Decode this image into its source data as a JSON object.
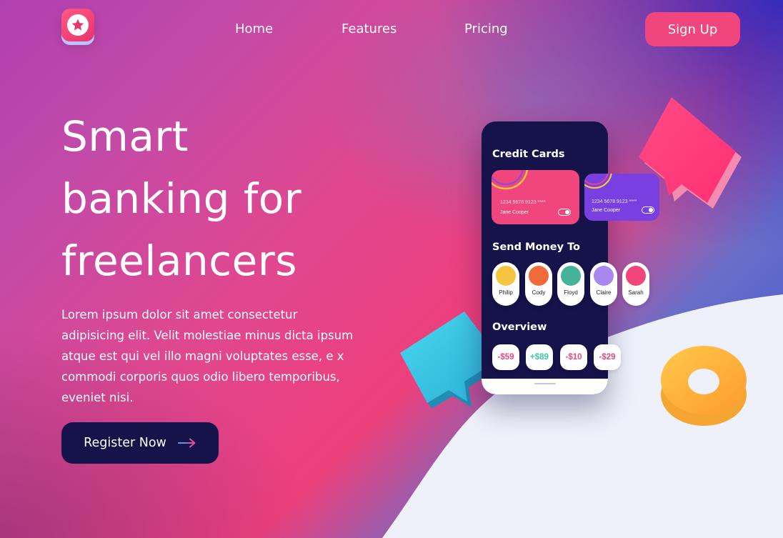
{
  "nav": {
    "logo_icon": "star-icon",
    "links": [
      "Home",
      "Features",
      "Pricing"
    ],
    "signup_label": "Sign Up"
  },
  "hero": {
    "title_lines": [
      "Smart",
      "banking for",
      "freelancers"
    ],
    "lead_lines": [
      "Lorem ipsum dolor sit amet consectetur",
      "adipisicing elit. Velit molestiae minus dicta ipsum",
      "atque est qui vel illo magni voluptates esse, e x",
      "commodi corporis quos odio libero temporibus,",
      "eveniet nisi."
    ],
    "cta_label": "Register Now",
    "cta_icon": "arrow-right-icon"
  },
  "phone": {
    "credit_title": "Credit Cards",
    "cards": [
      {
        "number": "1234 5678 9123 ****",
        "holder": "Jane Cooper",
        "color": "#f0457d"
      },
      {
        "number": "1234 5678 9123 ****",
        "holder": "Jane Cooper",
        "color": "#7a3fe0"
      }
    ],
    "send_title": "Send Money To",
    "contacts": [
      {
        "name": "Philip",
        "color": "#f5c542"
      },
      {
        "name": "Cody",
        "color": "#f06a3a"
      },
      {
        "name": "Floyd",
        "color": "#45b29a"
      },
      {
        "name": "Claire",
        "color": "#a987f0"
      },
      {
        "name": "Sarah",
        "color": "#f0457d"
      }
    ],
    "overview_title": "Overview",
    "amounts": [
      {
        "value": "-$59",
        "color": "#f0457d"
      },
      {
        "value": "+$89",
        "color": "#3cc7a8"
      },
      {
        "value": "-$10",
        "color": "#f0457d"
      },
      {
        "value": "-$29",
        "color": "#f0457d"
      }
    ]
  },
  "colors": {
    "accent": "#f0457d",
    "navy": "#16124a",
    "teal": "#3cc7de",
    "yellow": "#fcb53a"
  }
}
